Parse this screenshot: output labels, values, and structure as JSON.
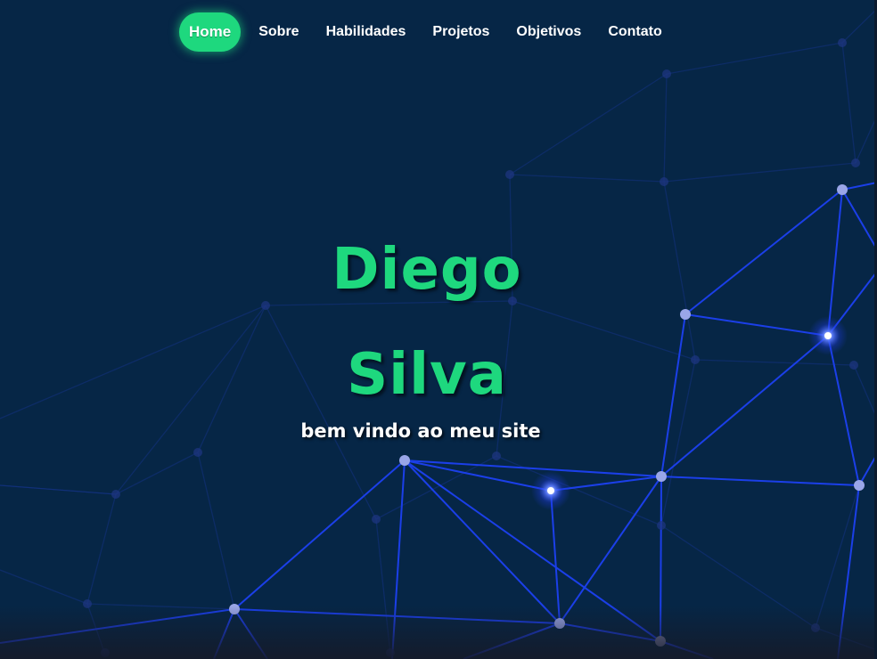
{
  "nav": {
    "items": [
      {
        "label": "Home",
        "active": true
      },
      {
        "label": "Sobre",
        "active": false
      },
      {
        "label": "Habilidades",
        "active": false
      },
      {
        "label": "Projetos",
        "active": false
      },
      {
        "label": "Objetivos",
        "active": false
      },
      {
        "label": "Contato",
        "active": false
      }
    ]
  },
  "hero": {
    "first_name": "Diego",
    "last_name": "Silva",
    "subtitle": "bem vindo ao meu site"
  },
  "colors": {
    "background": "#062646",
    "accent": "#1ed87e",
    "network_line": "#1a3ee0",
    "node": "#9aa6e8",
    "text": "#ffffff"
  }
}
